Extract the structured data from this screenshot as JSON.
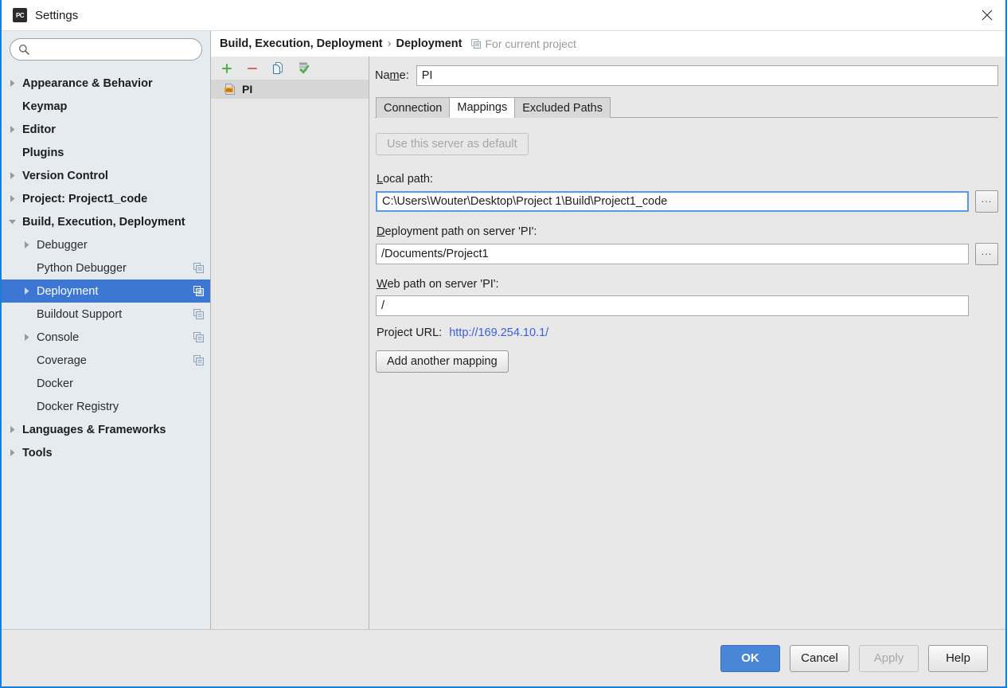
{
  "window": {
    "title": "Settings",
    "app_icon": "pycharm-icon",
    "app_icon_text": "PC",
    "close_icon": "close-icon"
  },
  "search": {
    "value": "",
    "placeholder": "",
    "icon": "search-icon"
  },
  "sidebar": {
    "items": [
      {
        "label": "Appearance & Behavior",
        "level": 0,
        "arrow": "collapsed",
        "badge": false,
        "selected": false
      },
      {
        "label": "Keymap",
        "level": 0,
        "arrow": "none",
        "badge": false,
        "selected": false
      },
      {
        "label": "Editor",
        "level": 0,
        "arrow": "collapsed",
        "badge": false,
        "selected": false
      },
      {
        "label": "Plugins",
        "level": 0,
        "arrow": "none",
        "badge": false,
        "selected": false
      },
      {
        "label": "Version Control",
        "level": 0,
        "arrow": "collapsed",
        "badge": false,
        "selected": false
      },
      {
        "label": "Project: Project1_code",
        "level": 0,
        "arrow": "collapsed",
        "badge": false,
        "selected": false
      },
      {
        "label": "Build, Execution, Deployment",
        "level": 0,
        "arrow": "expanded",
        "badge": false,
        "selected": false
      },
      {
        "label": "Debugger",
        "level": 1,
        "arrow": "collapsed",
        "badge": false,
        "selected": false
      },
      {
        "label": "Python Debugger",
        "level": 1,
        "arrow": "none",
        "badge": true,
        "selected": false
      },
      {
        "label": "Deployment",
        "level": 1,
        "arrow": "collapsed",
        "badge": true,
        "selected": true
      },
      {
        "label": "Buildout Support",
        "level": 1,
        "arrow": "none",
        "badge": true,
        "selected": false
      },
      {
        "label": "Console",
        "level": 1,
        "arrow": "collapsed",
        "badge": true,
        "selected": false
      },
      {
        "label": "Coverage",
        "level": 1,
        "arrow": "none",
        "badge": true,
        "selected": false
      },
      {
        "label": "Docker",
        "level": 1,
        "arrow": "none",
        "badge": false,
        "selected": false
      },
      {
        "label": "Docker Registry",
        "level": 1,
        "arrow": "none",
        "badge": false,
        "selected": false
      },
      {
        "label": "Languages & Frameworks",
        "level": 0,
        "arrow": "collapsed",
        "badge": false,
        "selected": false
      },
      {
        "label": "Tools",
        "level": 0,
        "arrow": "collapsed",
        "badge": false,
        "selected": false
      }
    ]
  },
  "breadcrumb": {
    "root": "Build, Execution, Deployment",
    "separator": "›",
    "current": "Deployment",
    "note": "For current project",
    "note_icon": "copy-project-icon"
  },
  "server_list": {
    "toolbar": [
      {
        "name": "add-server-button",
        "icon": "plus-icon"
      },
      {
        "name": "remove-server-button",
        "icon": "minus-icon"
      },
      {
        "name": "copy-server-button",
        "icon": "copy-icon"
      },
      {
        "name": "set-default-server-button",
        "icon": "server-check-icon"
      }
    ],
    "items": [
      {
        "label": "PI",
        "icon": "sftp-icon",
        "icon_text": "sftp",
        "selected": true
      }
    ]
  },
  "form": {
    "name_label": "Name:",
    "name_label_mnemonic": "m",
    "name_value": "PI",
    "tabs": [
      {
        "label": "Connection",
        "active": false
      },
      {
        "label": "Mappings",
        "active": true
      },
      {
        "label": "Excluded Paths",
        "active": false
      }
    ],
    "use_default_button": "Use this server as default",
    "use_default_disabled": true,
    "local_path_label": "Local path:",
    "local_path_mnemonic": "L",
    "local_path_value": "C:\\Users\\Wouter\\Desktop\\Project 1\\Build\\Project1_code",
    "deployment_path_label": "Deployment path on server 'PI':",
    "deployment_path_mnemonic": "D",
    "deployment_path_value": "/Documents/Project1",
    "web_path_label": "Web path on server 'PI':",
    "web_path_mnemonic": "W",
    "web_path_value": "/",
    "browse_button_label": "...",
    "project_url_label": "Project URL:",
    "project_url_value": "http://169.254.10.1/",
    "add_mapping_button": "Add another mapping"
  },
  "footer": {
    "ok": "OK",
    "cancel": "Cancel",
    "apply": "Apply",
    "apply_disabled": true,
    "help": "Help"
  },
  "colors": {
    "selection_blue": "#3d77d4",
    "primary_button": "#4a86d8",
    "link_blue": "#3b5ee0",
    "sidebar_bg": "#e6ebf0",
    "panel_bg": "#e8e8e8",
    "dialog_border": "#1a7fd4"
  }
}
